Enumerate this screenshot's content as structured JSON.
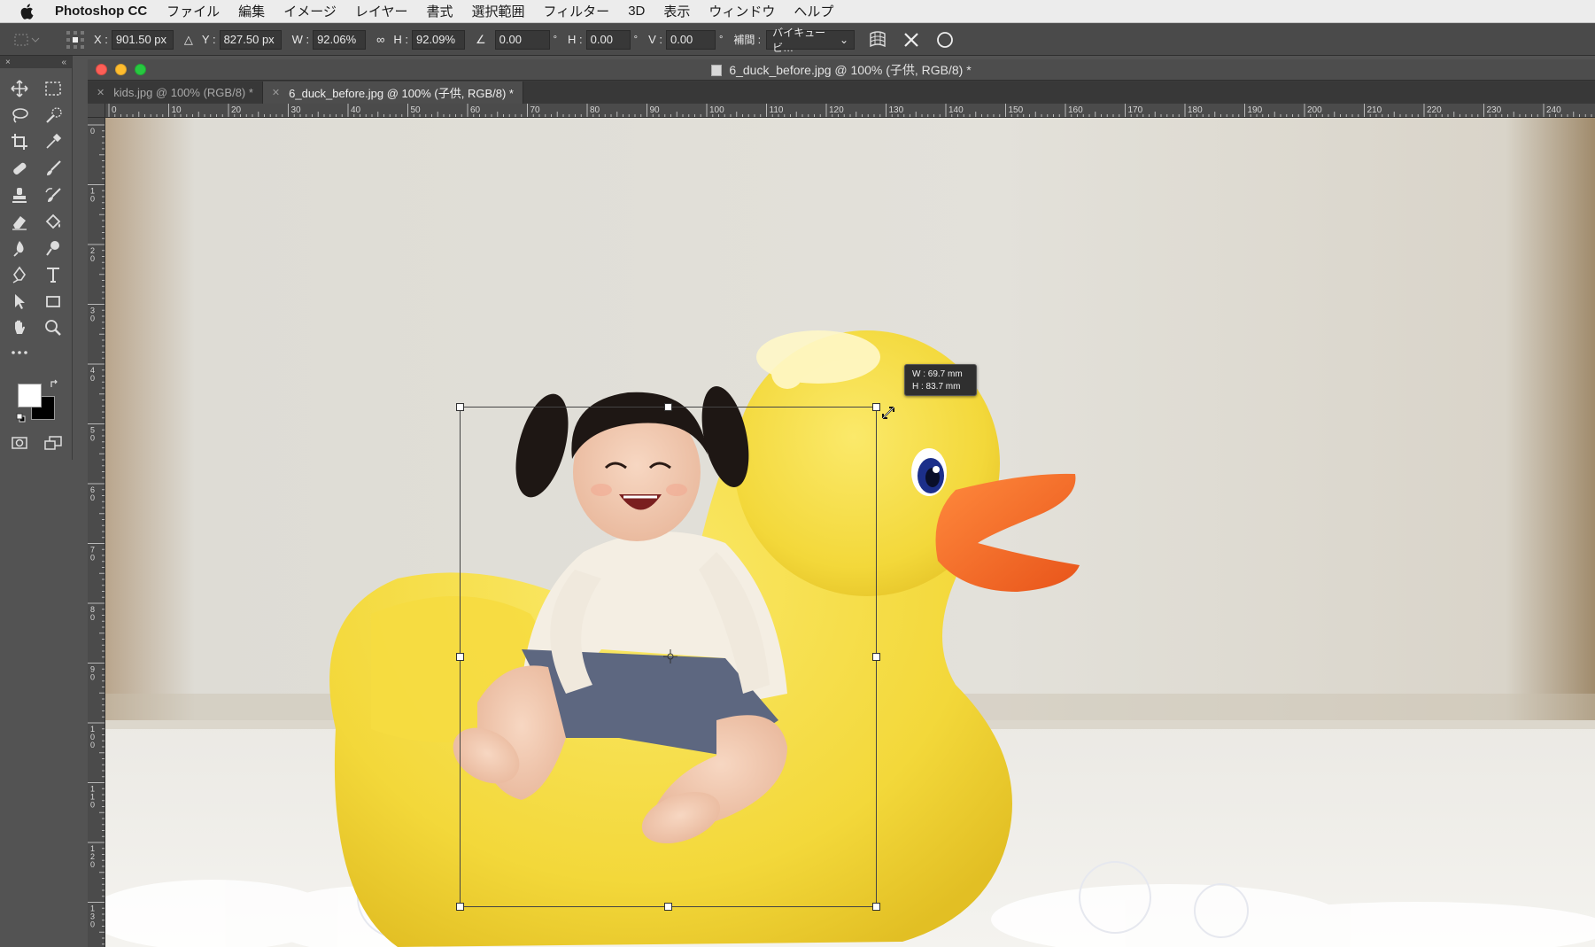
{
  "menubar": {
    "app_name": "Photoshop CC",
    "items": [
      "ファイル",
      "編集",
      "イメージ",
      "レイヤー",
      "書式",
      "選択範囲",
      "フィルター",
      "3D",
      "表示",
      "ウィンドウ",
      "ヘルプ"
    ]
  },
  "options": {
    "x_label": "X :",
    "x_value": "901.50 px",
    "y_label": "Y :",
    "y_value": "827.50 px",
    "w_label": "W :",
    "w_value": "92.06%",
    "h_label": "H :",
    "h_value": "92.09%",
    "angle_value": "0.00",
    "hskew_label": "H :",
    "hskew_value": "0.00",
    "vskew_label": "V :",
    "vskew_value": "0.00",
    "degree_symbol": "°",
    "interp_label": "補間 :",
    "interp_value": "バイキュービ…"
  },
  "document": {
    "title": "6_duck_before.jpg @ 100% (子供, RGB/8) *",
    "tabs": [
      {
        "label": "kids.jpg @ 100% (RGB/8) *",
        "active": false
      },
      {
        "label": "6_duck_before.jpg @ 100% (子供, RGB/8) *",
        "active": true
      }
    ]
  },
  "rulers": {
    "horizontal": [
      "0",
      "10",
      "20",
      "30",
      "40",
      "50",
      "60",
      "70",
      "80",
      "90",
      "100",
      "110",
      "120",
      "130",
      "140",
      "150",
      "160",
      "170",
      "180",
      "190",
      "200",
      "210",
      "220",
      "230",
      "240"
    ],
    "vertical": [
      "0",
      "1 0",
      "2 0",
      "3 0",
      "4 0",
      "5 0",
      "6 0",
      "7 0",
      "8 0",
      "9 0",
      "1 0 0",
      "1 1 0",
      "1 2 0",
      "1 3 0"
    ]
  },
  "transform_tooltip": {
    "w": "W : 69.7 mm",
    "h": "H : 83.7 mm"
  },
  "colors": {
    "foreground": "#ffffff",
    "background": "#000000",
    "duck": "#f5dc3a",
    "beak": "#f26a1d"
  }
}
